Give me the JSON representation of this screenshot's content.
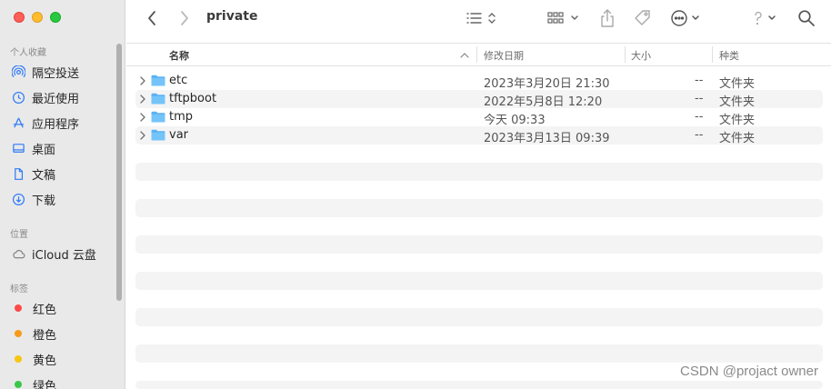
{
  "window": {
    "title": "private"
  },
  "sidebar": {
    "favorites_title": "个人收藏",
    "favorites": [
      {
        "label": "隔空投送",
        "icon": "airdrop-icon"
      },
      {
        "label": "最近使用",
        "icon": "clock-icon"
      },
      {
        "label": "应用程序",
        "icon": "applications-icon"
      },
      {
        "label": "桌面",
        "icon": "desktop-icon"
      },
      {
        "label": "文稿",
        "icon": "document-icon"
      },
      {
        "label": "下载",
        "icon": "download-icon"
      }
    ],
    "locations_title": "位置",
    "locations": [
      {
        "label": "iCloud 云盘",
        "icon": "cloud-icon"
      }
    ],
    "tags_title": "标签",
    "tags": [
      {
        "label": "红色",
        "color": "#fe4a49"
      },
      {
        "label": "橙色",
        "color": "#f79a1d"
      },
      {
        "label": "黄色",
        "color": "#f6c614"
      },
      {
        "label": "绿色",
        "color": "#3ac849"
      }
    ]
  },
  "table": {
    "columns": {
      "name": "名称",
      "modified": "修改日期",
      "size": "大小",
      "kind": "种类"
    },
    "rows": [
      {
        "name": "etc",
        "modified": "2023年3月20日 21:30",
        "size": "--",
        "kind": "文件夹"
      },
      {
        "name": "tftpboot",
        "modified": "2022年5月8日 12:20",
        "size": "--",
        "kind": "文件夹"
      },
      {
        "name": "tmp",
        "modified": "今天 09:33",
        "size": "--",
        "kind": "文件夹"
      },
      {
        "name": "var",
        "modified": "2023年3月13日 09:39",
        "size": "--",
        "kind": "文件夹"
      }
    ]
  },
  "colors": {
    "accent": "#2f7bf6",
    "folder": "#5ab1f3"
  },
  "watermark": "CSDN @projact owner"
}
